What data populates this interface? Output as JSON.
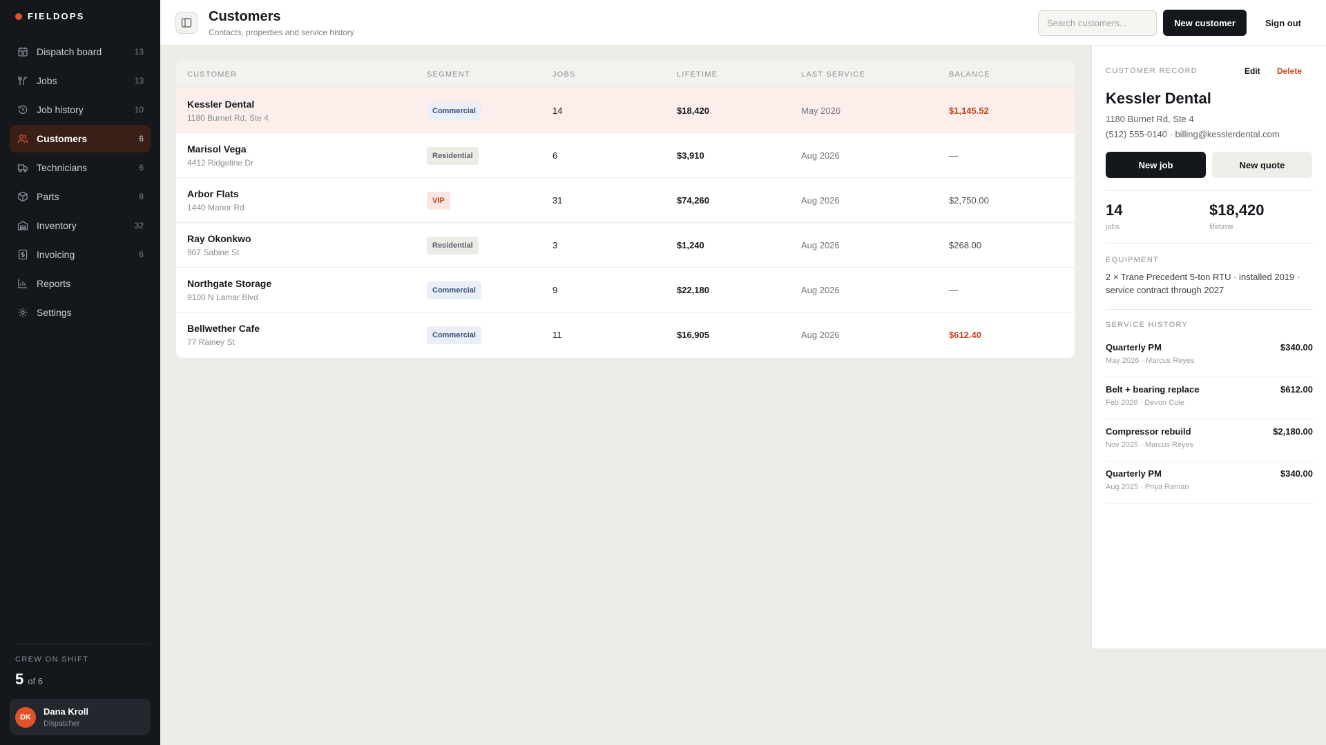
{
  "brand": {
    "name": "FIELDOPS"
  },
  "sidebar": {
    "items": [
      {
        "label": "Dispatch board",
        "count": "13",
        "icon": "dispatch-icon"
      },
      {
        "label": "Jobs",
        "count": "13",
        "icon": "tools-icon"
      },
      {
        "label": "Job history",
        "count": "10",
        "icon": "history-icon"
      },
      {
        "label": "Customers",
        "count": "6",
        "icon": "users-icon",
        "active": true
      },
      {
        "label": "Technicians",
        "count": "6",
        "icon": "truck-icon"
      },
      {
        "label": "Parts",
        "count": "8",
        "icon": "box-icon"
      },
      {
        "label": "Inventory",
        "count": "32",
        "icon": "warehouse-icon"
      },
      {
        "label": "Invoicing",
        "count": "6",
        "icon": "invoice-icon"
      },
      {
        "label": "Reports",
        "count": "",
        "icon": "chart-icon"
      },
      {
        "label": "Settings",
        "count": "",
        "icon": "gear-icon"
      }
    ],
    "crew": {
      "label": "CREW ON SHIFT",
      "value": "5",
      "of": "of 6"
    },
    "user": {
      "initials": "DK",
      "name": "Dana Kroll",
      "role": "Dispatcher"
    }
  },
  "header": {
    "title": "Customers",
    "subtitle": "Contacts, properties and service history",
    "search_placeholder": "Search customers...",
    "new_customer": "New customer",
    "sign_out": "Sign out"
  },
  "table": {
    "columns": [
      "CUSTOMER",
      "SEGMENT",
      "JOBS",
      "LIFETIME",
      "LAST SERVICE",
      "BALANCE"
    ],
    "rows": [
      {
        "name": "Kessler Dental",
        "address": "1180 Burnet Rd, Ste 4",
        "segment": "Commercial",
        "jobs": "14",
        "lifetime": "$18,420",
        "last": "May 2026",
        "balance": "$1,145.52",
        "due": true,
        "selected": true
      },
      {
        "name": "Marisol Vega",
        "address": "4412 Ridgeline Dr",
        "segment": "Residential",
        "jobs": "6",
        "lifetime": "$3,910",
        "last": "Aug 2026",
        "balance": "—",
        "due": false
      },
      {
        "name": "Arbor Flats",
        "address": "1440 Manor Rd",
        "segment": "VIP",
        "jobs": "31",
        "lifetime": "$74,260",
        "last": "Aug 2026",
        "balance": "$2,750.00",
        "due": false
      },
      {
        "name": "Ray Okonkwo",
        "address": "907 Sabine St",
        "segment": "Residential",
        "jobs": "3",
        "lifetime": "$1,240",
        "last": "Aug 2026",
        "balance": "$268.00",
        "due": false
      },
      {
        "name": "Northgate Storage",
        "address": "9100 N Lamar Blvd",
        "segment": "Commercial",
        "jobs": "9",
        "lifetime": "$22,180",
        "last": "Aug 2026",
        "balance": "—",
        "due": false
      },
      {
        "name": "Bellwether Cafe",
        "address": "77 Rainey St",
        "segment": "Commercial",
        "jobs": "11",
        "lifetime": "$16,905",
        "last": "Aug 2026",
        "balance": "$612.40",
        "due": true
      }
    ]
  },
  "panel": {
    "record_label": "CUSTOMER RECORD",
    "edit": "Edit",
    "delete": "Delete",
    "name": "Kessler Dental",
    "address": "1180 Burnet Rd, Ste 4",
    "contact": "(512) 555-0140 · billing@kesslerdental.com",
    "new_job": "New job",
    "new_quote": "New quote",
    "stats": {
      "jobs": "14",
      "jobs_label": "jobs",
      "lifetime": "$18,420",
      "lifetime_label": "lifetime"
    },
    "equipment_label": "EQUIPMENT",
    "equipment": "2 × Trane Precedent 5-ton RTU · installed 2019 · service contract through 2027",
    "history_label": "SERVICE HISTORY",
    "history": [
      {
        "title": "Quarterly PM",
        "meta": "May 2026 · Marcus Reyes",
        "amount": "$340.00"
      },
      {
        "title": "Belt + bearing replace",
        "meta": "Feb 2026 · Devon Cole",
        "amount": "$612.00"
      },
      {
        "title": "Compressor rebuild",
        "meta": "Nov 2025 · Marcus Reyes",
        "amount": "$2,180.00"
      },
      {
        "title": "Quarterly PM",
        "meta": "Aug 2025 · Priya Raman",
        "amount": "$340.00"
      }
    ]
  },
  "colors": {
    "accent": "#e4522a",
    "danger": "#c6401c",
    "sidebar_bg": "#14171c",
    "page_bg": "#eeece7"
  }
}
